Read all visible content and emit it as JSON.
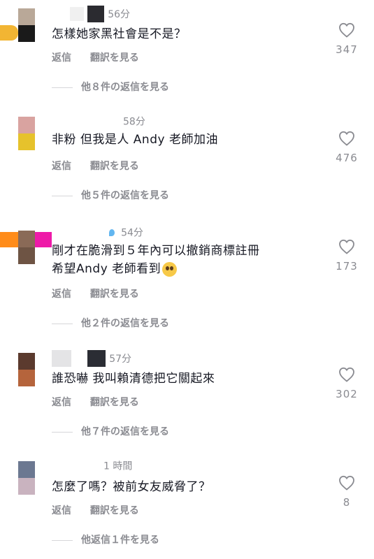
{
  "comments": [
    {
      "time": "56分",
      "text_lines": [
        "怎樣她家黑社會是不是？"
      ],
      "reply": "返信",
      "translate": "翻訳を見る",
      "likes": "347",
      "view_replies": "他８件の返信を見る",
      "avatar_colors": [
        "#b9a898",
        "#1a1a1a"
      ]
    },
    {
      "time": "58分",
      "text_lines": [
        "非粉 但我是人 Andy 老師加油"
      ],
      "reply": "返信",
      "translate": "翻訳を見る",
      "likes": "476",
      "view_replies": "他５件の返信を見る",
      "avatar_colors": [
        "#d9a3a0",
        "#e6c22c"
      ]
    },
    {
      "time": "54分",
      "text_lines": [
        "剛才在脆滑到５年內可以撤銷商標註冊",
        "希望Andy 老師看到"
      ],
      "reply": "返信",
      "translate": "翻訳を見る",
      "likes": "173",
      "view_replies": "他２件の返信を見る",
      "avatar_colors": [
        "#8a6a57",
        "#6e5444"
      ]
    },
    {
      "time": "57分",
      "text_lines": [
        "誰恐嚇 我叫賴清德把它關起來"
      ],
      "reply": "返信",
      "translate": "翻訳を見る",
      "likes": "302",
      "view_replies": "他７件の返信を見る",
      "avatar_colors": [
        "#5b3a2e",
        "#b5643c"
      ]
    },
    {
      "time": "1 時間",
      "text_lines": [
        "怎麼了嗎？被前女友威脅了？"
      ],
      "reply": "返信",
      "translate": "翻訳を見る",
      "likes": "8",
      "view_replies": "他返信１件を見る",
      "avatar_colors": [
        "#6c7891",
        "#c9b3bf"
      ]
    }
  ],
  "icons": {
    "like": "heart-outline-icon",
    "emoji": "pleading-face-emoji"
  },
  "colors": {
    "text": "#161823",
    "secondary": "#8a8b91"
  }
}
